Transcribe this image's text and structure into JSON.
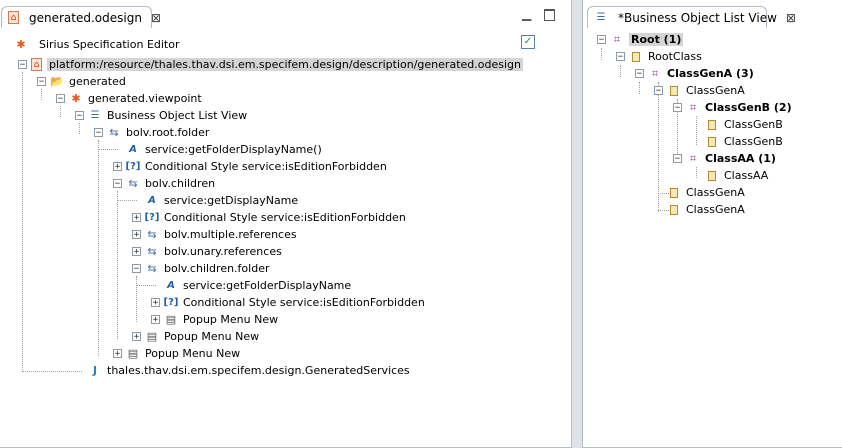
{
  "left_tab": {
    "title": "generated.odesign",
    "close": "⊠"
  },
  "left_controls": {
    "minimize": "▁"
  },
  "editor": {
    "title": "Sirius Specification Editor",
    "check": "✓"
  },
  "odesign_tree": [
    {
      "label": "platform:/resource/thales.thav.dsi.em.specifem.design/description/generated.odesign",
      "icon": "odesign-file-icon",
      "toggle": "−"
    },
    {
      "label": "generated",
      "icon": "folder-icon",
      "toggle": "−"
    },
    {
      "label": "generated.viewpoint",
      "icon": "viewpoint-icon",
      "toggle": "−"
    },
    {
      "label": "Business Object List View",
      "icon": "list-view-icon",
      "toggle": "−"
    },
    {
      "label": "bolv.root.folder",
      "icon": "navigation-icon",
      "toggle": "−"
    },
    {
      "label": "service:getFolderDisplayName()",
      "icon": "label-expression-icon",
      "toggle": ""
    },
    {
      "label": "Conditional Style service:isEditionForbidden",
      "icon": "conditional-style-icon",
      "toggle": "+"
    },
    {
      "label": "bolv.children",
      "icon": "navigation-icon",
      "toggle": "−"
    },
    {
      "label": "service:getDisplayName",
      "icon": "label-expression-icon",
      "toggle": ""
    },
    {
      "label": "Conditional Style service:isEditionForbidden",
      "icon": "conditional-style-icon",
      "toggle": "+"
    },
    {
      "label": "bolv.multiple.references",
      "icon": "navigation-icon",
      "toggle": "+"
    },
    {
      "label": "bolv.unary.references",
      "icon": "navigation-icon",
      "toggle": "+"
    },
    {
      "label": "bolv.children.folder",
      "icon": "navigation-icon",
      "toggle": "−"
    },
    {
      "label": "service:getFolderDisplayName",
      "icon": "label-expression-icon",
      "toggle": ""
    },
    {
      "label": "Conditional Style service:isEditionForbidden",
      "icon": "conditional-style-icon",
      "toggle": "+"
    },
    {
      "label": "Popup Menu New",
      "icon": "popup-menu-icon",
      "toggle": "+"
    },
    {
      "label": "Popup Menu New",
      "icon": "popup-menu-icon",
      "toggle": "+"
    },
    {
      "label": "Popup Menu New",
      "icon": "popup-menu-icon",
      "toggle": "+"
    },
    {
      "label": "thales.thav.dsi.em.specifem.design.GeneratedServices",
      "icon": "java-extension-icon",
      "toggle": ""
    }
  ],
  "right_tab": {
    "title": "*Business Object List View",
    "close": "⊠"
  },
  "instance_tree": [
    {
      "label": "Root (1)",
      "icon": "container-icon",
      "toggle": "−"
    },
    {
      "label": "RootClass",
      "icon": "class-icon",
      "toggle": "−"
    },
    {
      "label": "ClassGenA (3)",
      "icon": "container-icon",
      "toggle": "−"
    },
    {
      "label": "ClassGenA",
      "icon": "class-icon",
      "toggle": "−"
    },
    {
      "label": "ClassGenB (2)",
      "icon": "container-icon",
      "toggle": "−"
    },
    {
      "label": "ClassGenB",
      "icon": "class-icon",
      "toggle": ""
    },
    {
      "label": "ClassGenB",
      "icon": "class-icon",
      "toggle": ""
    },
    {
      "label": "ClassAA (1)",
      "icon": "container-icon",
      "toggle": "−"
    },
    {
      "label": "ClassAA",
      "icon": "class-icon",
      "toggle": ""
    },
    {
      "label": "ClassGenA",
      "icon": "class-icon",
      "toggle": ""
    },
    {
      "label": "ClassGenA",
      "icon": "class-icon",
      "toggle": ""
    }
  ]
}
